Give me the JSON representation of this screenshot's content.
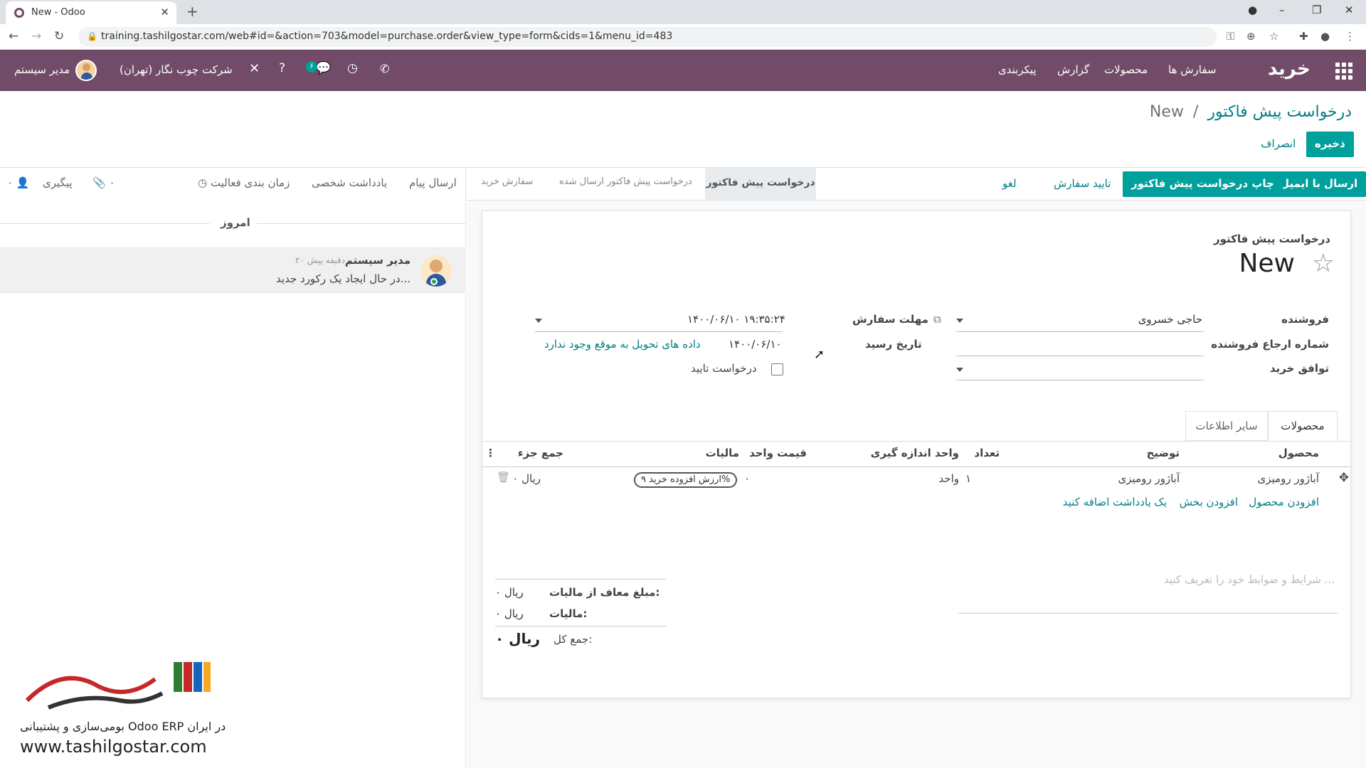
{
  "browser": {
    "tab_title": "New - Odoo",
    "url": "training.tashilgostar.com/web#id=&action=703&model=purchase.order&view_type=form&cids=1&menu_id=483"
  },
  "navbar": {
    "app_name": "خرید",
    "menu": [
      "سفارش ها",
      "محصولات",
      "گزارش",
      "پیکربندی"
    ],
    "company": "شرکت چوب نگار (تهران)",
    "user": "مدیر سیستم",
    "chat_badge": "۶"
  },
  "breadcrumb": {
    "parent": "درخواست پیش فاکتور",
    "current": "New"
  },
  "actions": {
    "save": "ذخیره",
    "discard": "انصراف"
  },
  "header_buttons": {
    "send_email": "ارسال با ایمیل",
    "print_rfq": "چاپ درخواست پیش فاکتور",
    "confirm_order": "تایید سفارش",
    "cancel": "لغو"
  },
  "stages": {
    "active": "درخواست پیش فاکتور",
    "sent": "درخواست پیش فاکتور ارسال شده",
    "purchase": "سفارش خرید"
  },
  "chatter": {
    "send_message": "ارسال پیام",
    "log_note": "یادداشت شخصی",
    "schedule_activity": "زمان بندی فعالیت",
    "attachments_count": "۰",
    "follow": "پیگیری",
    "followers_count": "۰",
    "day_label": "امروز",
    "message": {
      "author": "مدیر سیستم",
      "time": "۲۰ دقیقه پیش",
      "body": "در حال ایجاد یک رکورد جدید..."
    }
  },
  "form": {
    "doc_type": "درخواست پیش فاکتور",
    "name": "New",
    "vendor_label": "فروشنده",
    "vendor_value": "حاجی خسروی",
    "vendor_ref_label": "شماره ارجاع فروشنده",
    "agreement_label": "توافق خرید",
    "order_deadline_label": "مهلت سفارش",
    "order_deadline_value": "۱۴۰۰/۰۶/۱۰ ۱۹:۳۵:۲۴",
    "receipt_date_label": "تاریخ رسید",
    "receipt_date_value": "۱۴۰۰/۰۶/۱۰",
    "delivery_warning": "داده های تحویل به موقع وجود ندارد",
    "confirmation_label": "درخواست تایید"
  },
  "notebook": {
    "tabs": [
      "محصولات",
      "سایر اطلاعات"
    ]
  },
  "lines": {
    "headers": {
      "product": "محصول",
      "description": "توضیح",
      "qty": "تعداد",
      "uom": "واحد اندازه گیری",
      "unit_price": "قیمت واحد",
      "taxes": "مالیات",
      "subtotal": "جمع جزء"
    },
    "rows": [
      {
        "product": "آباژور رومیزی",
        "description": "آباژور رومیزی",
        "qty": "۱",
        "uom": "واحد",
        "unit_price": "۰",
        "tax": "ارزش افزوده خرید ۹%",
        "subtotal": "۰ ریال"
      }
    ],
    "add_product": "افزودن محصول",
    "add_section": "افزودن بخش",
    "add_note": "یک یادداشت اضافه کنید"
  },
  "terms_placeholder": "شرایط و ضوابط خود را تعریف کنید ...",
  "totals": {
    "untaxed_label": "مبلغ معاف از مالیات:",
    "untaxed_value": "۰ ریال",
    "tax_label": "مالیات:",
    "tax_value": "۰ ریال",
    "total_label": "جمع کل:",
    "total_value": "۰ ریال"
  },
  "watermark": {
    "caption": "بومی‌سازی و پشتیبانی Odoo ERP در ایران",
    "url": "www.tashilgostar.com"
  }
}
